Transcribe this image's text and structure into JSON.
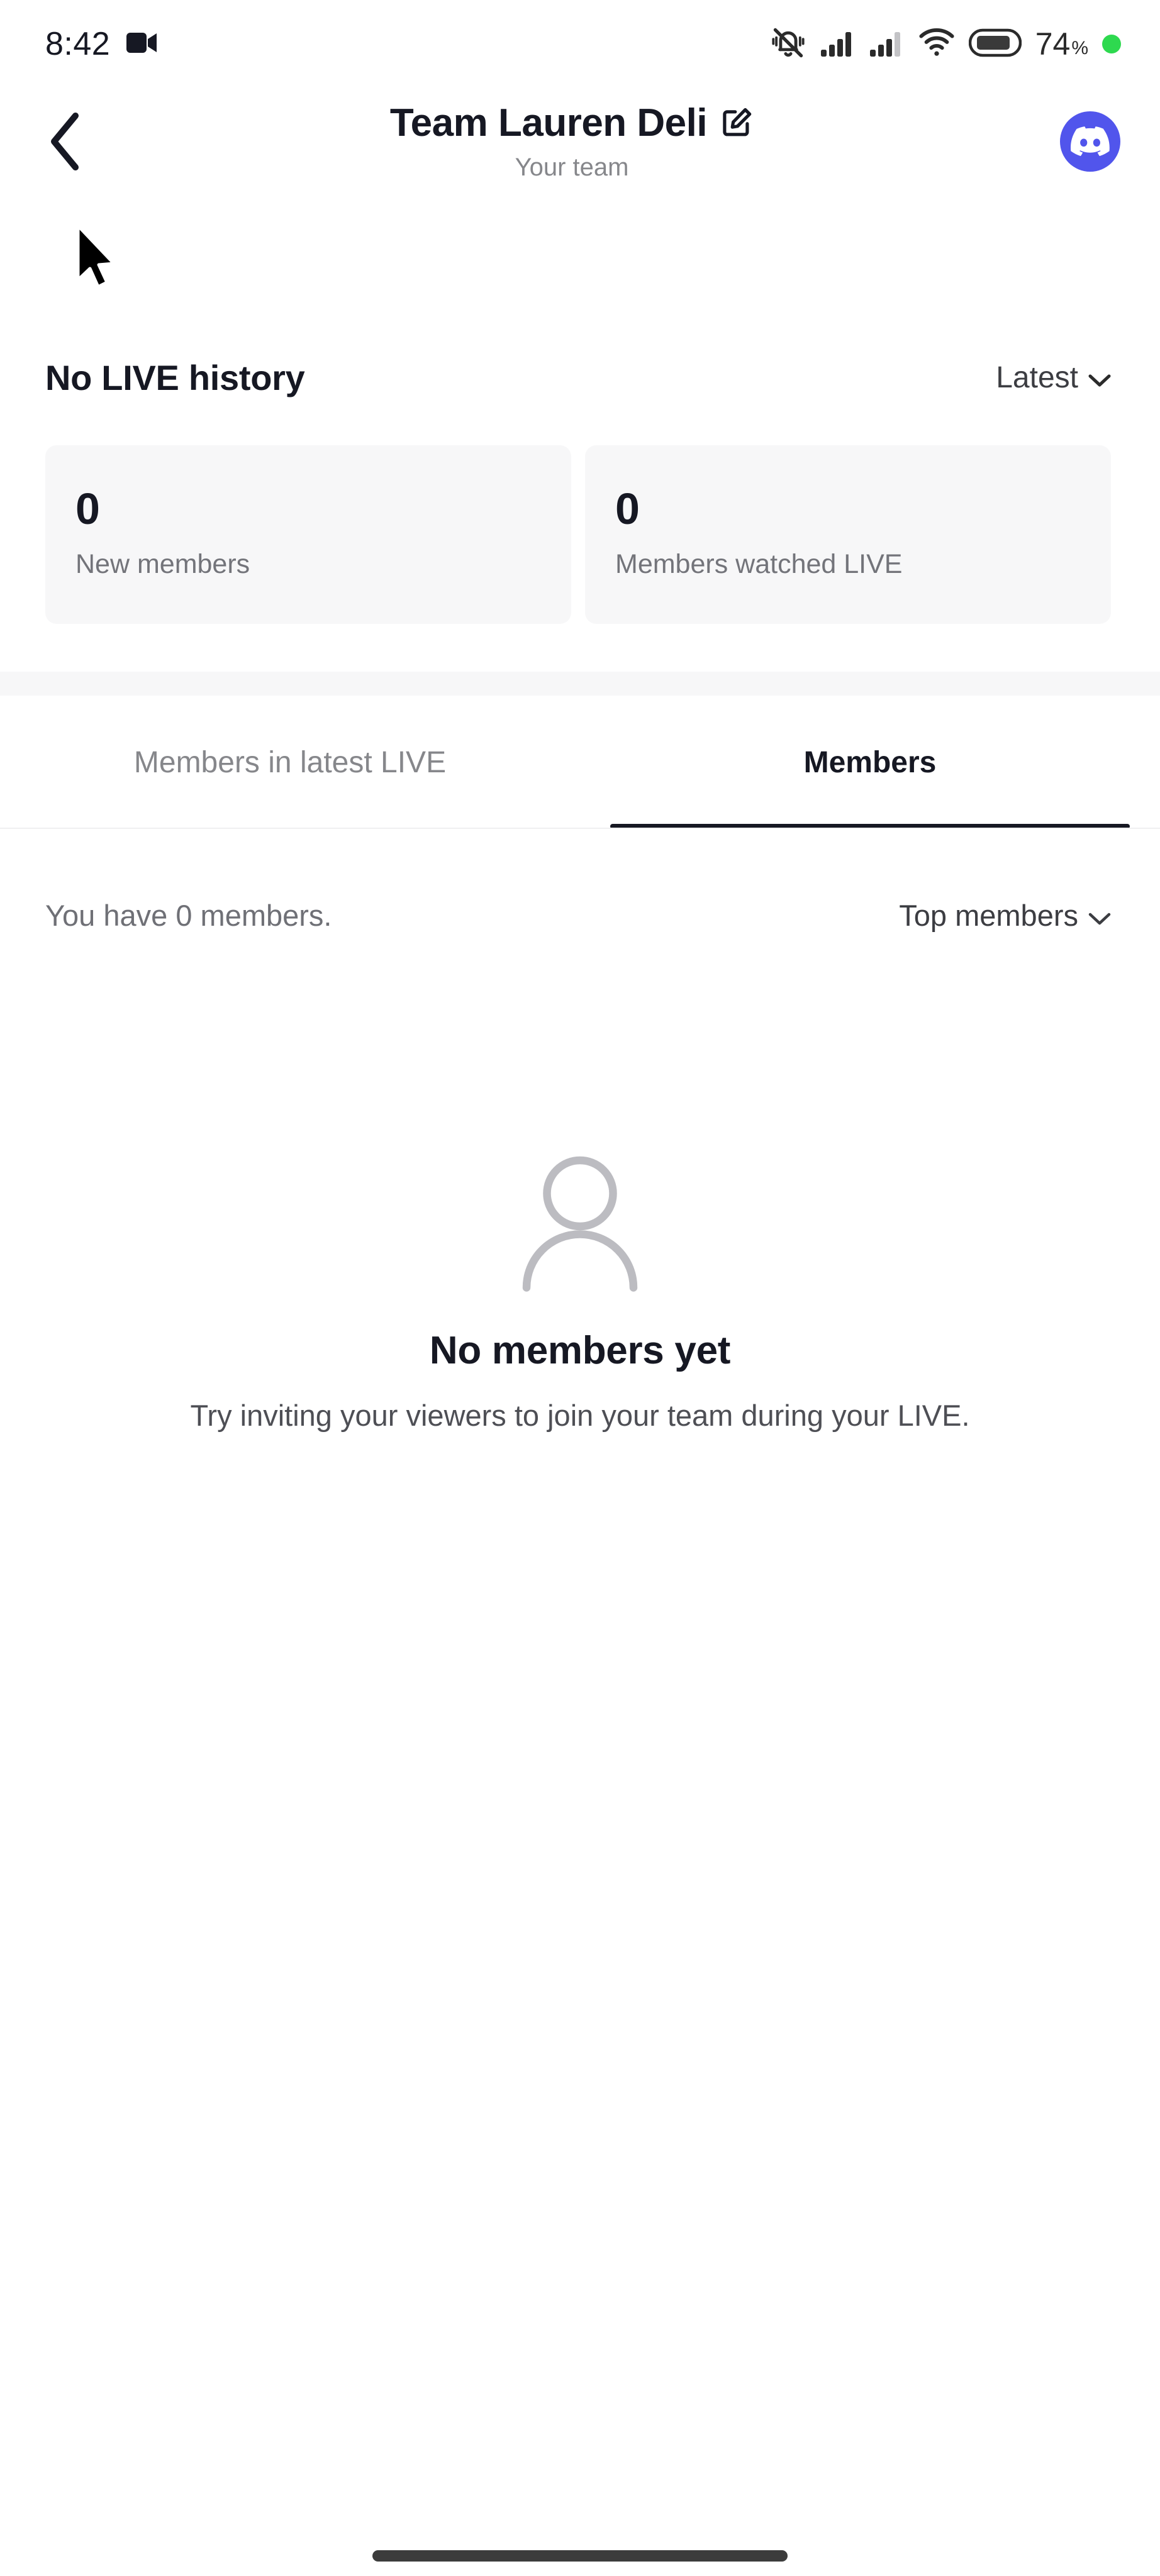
{
  "status_bar": {
    "time": "8:42",
    "left_icons": [
      "video-camera-icon"
    ],
    "right_icons": [
      "bell-muted-icon",
      "signal-bars-icon",
      "signal-bars-secondary-icon",
      "wifi-icon",
      "battery-icon"
    ],
    "battery_level": "74",
    "battery_percent_sign": "%",
    "indicator_dot_color": "#2ed94f"
  },
  "header": {
    "back_label": "Back",
    "title": "Team Lauren Deli",
    "subtitle": "Your team",
    "edit_icon": "edit-pencil-icon",
    "avatar_icon": "discord-logo-icon",
    "avatar_color": "#5155ec"
  },
  "live_history": {
    "title": "No LIVE history",
    "sort_label": "Latest",
    "sort_chevron": "chevron-down-icon"
  },
  "stats": [
    {
      "value": "0",
      "label": "New members"
    },
    {
      "value": "0",
      "label": "Members watched LIVE"
    }
  ],
  "tabs": [
    {
      "label": "Members in latest LIVE",
      "active": false
    },
    {
      "label": "Members",
      "active": true
    }
  ],
  "members_header": {
    "count_text": "You have 0 members.",
    "sort_label": "Top members",
    "sort_chevron": "chevron-down-icon"
  },
  "empty_state": {
    "icon": "person-placeholder-icon",
    "title": "No members yet",
    "description": "Try inviting your viewers to join your team during your LIVE."
  },
  "colors": {
    "card_background": "#f7f7f8",
    "primary_text": "#161823",
    "secondary_text": "#86878b",
    "accent": "#5155ec"
  }
}
